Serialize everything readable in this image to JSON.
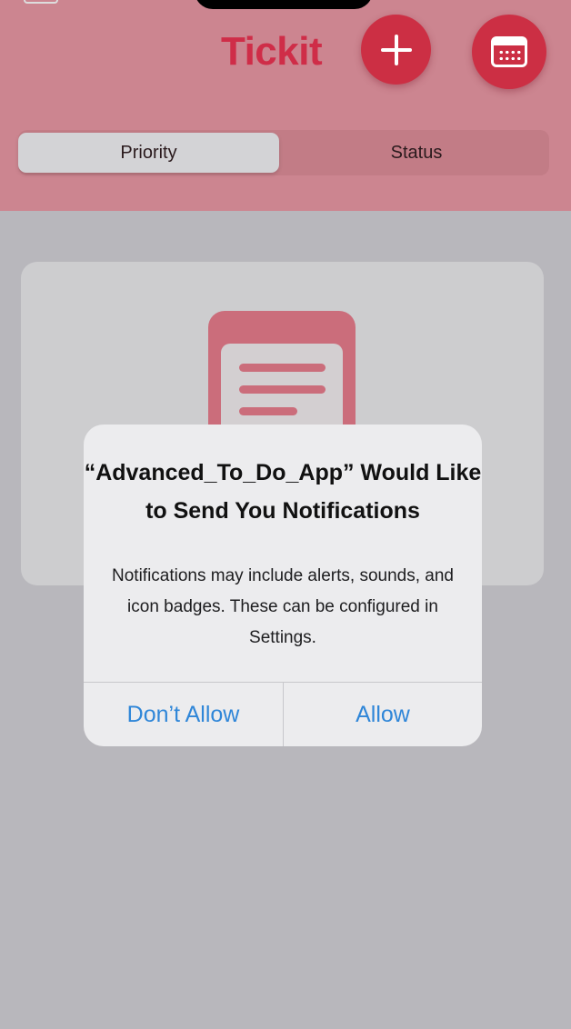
{
  "app": {
    "title": "Tickit",
    "accent_color": "#cc2f44",
    "header_color": "#cc8590"
  },
  "header": {
    "add_button_icon": "plus-icon",
    "calendar_button_icon": "calendar-icon"
  },
  "segmented_control": {
    "options": [
      "Priority",
      "Status"
    ],
    "selected": "Priority"
  },
  "empty_state": {
    "icon": "clipboard-icon"
  },
  "alert": {
    "title": "“Advanced_To_Do_App” Would Like to Send You Notifications",
    "message": "Notifications may include alerts, sounds, and icon badges. These can be configured in Settings.",
    "buttons": {
      "deny": "Don’t Allow",
      "allow": "Allow"
    },
    "button_color": "#2f86d8"
  }
}
